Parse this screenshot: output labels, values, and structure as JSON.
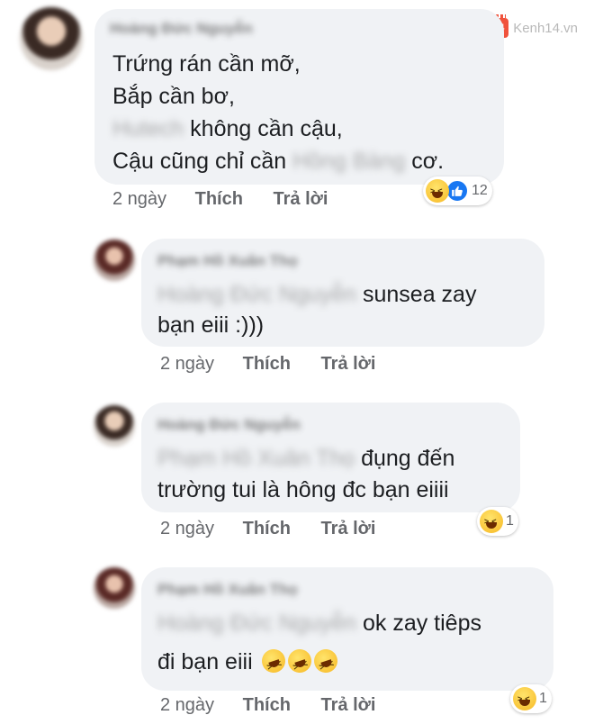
{
  "watermark": {
    "badge": "14",
    "text": "Kenh14.vn"
  },
  "comments": [
    {
      "name": "Hoàng Đức Nguyễn",
      "lines": [
        "Trứng rán cần mỡ,",
        "Bắp cần bơ,",
        "không cần cậu,",
        "Cậu cũng chỉ cần",
        "cơ."
      ],
      "blurred": [
        "Hutech",
        "Hồng Bàng"
      ],
      "time": "2 ngày",
      "like": "Thích",
      "reply": "Trả lời",
      "reactions": {
        "icons": [
          "haha-icon",
          "like-icon"
        ],
        "count": "12"
      }
    },
    {
      "name": "Phạm Hồ Xuân Thọ",
      "mention": "Hoàng Đức Nguyễn",
      "lines": [
        "sunsea zay",
        "bạn eiii :)))"
      ],
      "time": "2 ngày",
      "like": "Thích",
      "reply": "Trả lời"
    },
    {
      "name": "Hoàng Đức Nguyễn",
      "mention": "Phạm Hồ Xuân Thọ",
      "lines": [
        "đụng đến",
        "trường tui là hông đc bạn eiiii"
      ],
      "time": "2 ngày",
      "like": "Thích",
      "reply": "Trả lời",
      "reactions": {
        "icons": [
          "haha-icon"
        ],
        "count": "1"
      }
    },
    {
      "name": "Phạm Hồ Xuân Thọ",
      "mention": "Hoàng Đức Nguyễn",
      "lines": [
        "ok zay tiêps",
        "đi bạn eiii"
      ],
      "emojis": [
        "rofl-emoji",
        "rofl-emoji",
        "rofl-emoji"
      ],
      "time": "2 ngày",
      "like": "Thích",
      "reply": "Trả lời",
      "reactions": {
        "icons": [
          "haha-icon"
        ],
        "count": "1"
      }
    }
  ]
}
